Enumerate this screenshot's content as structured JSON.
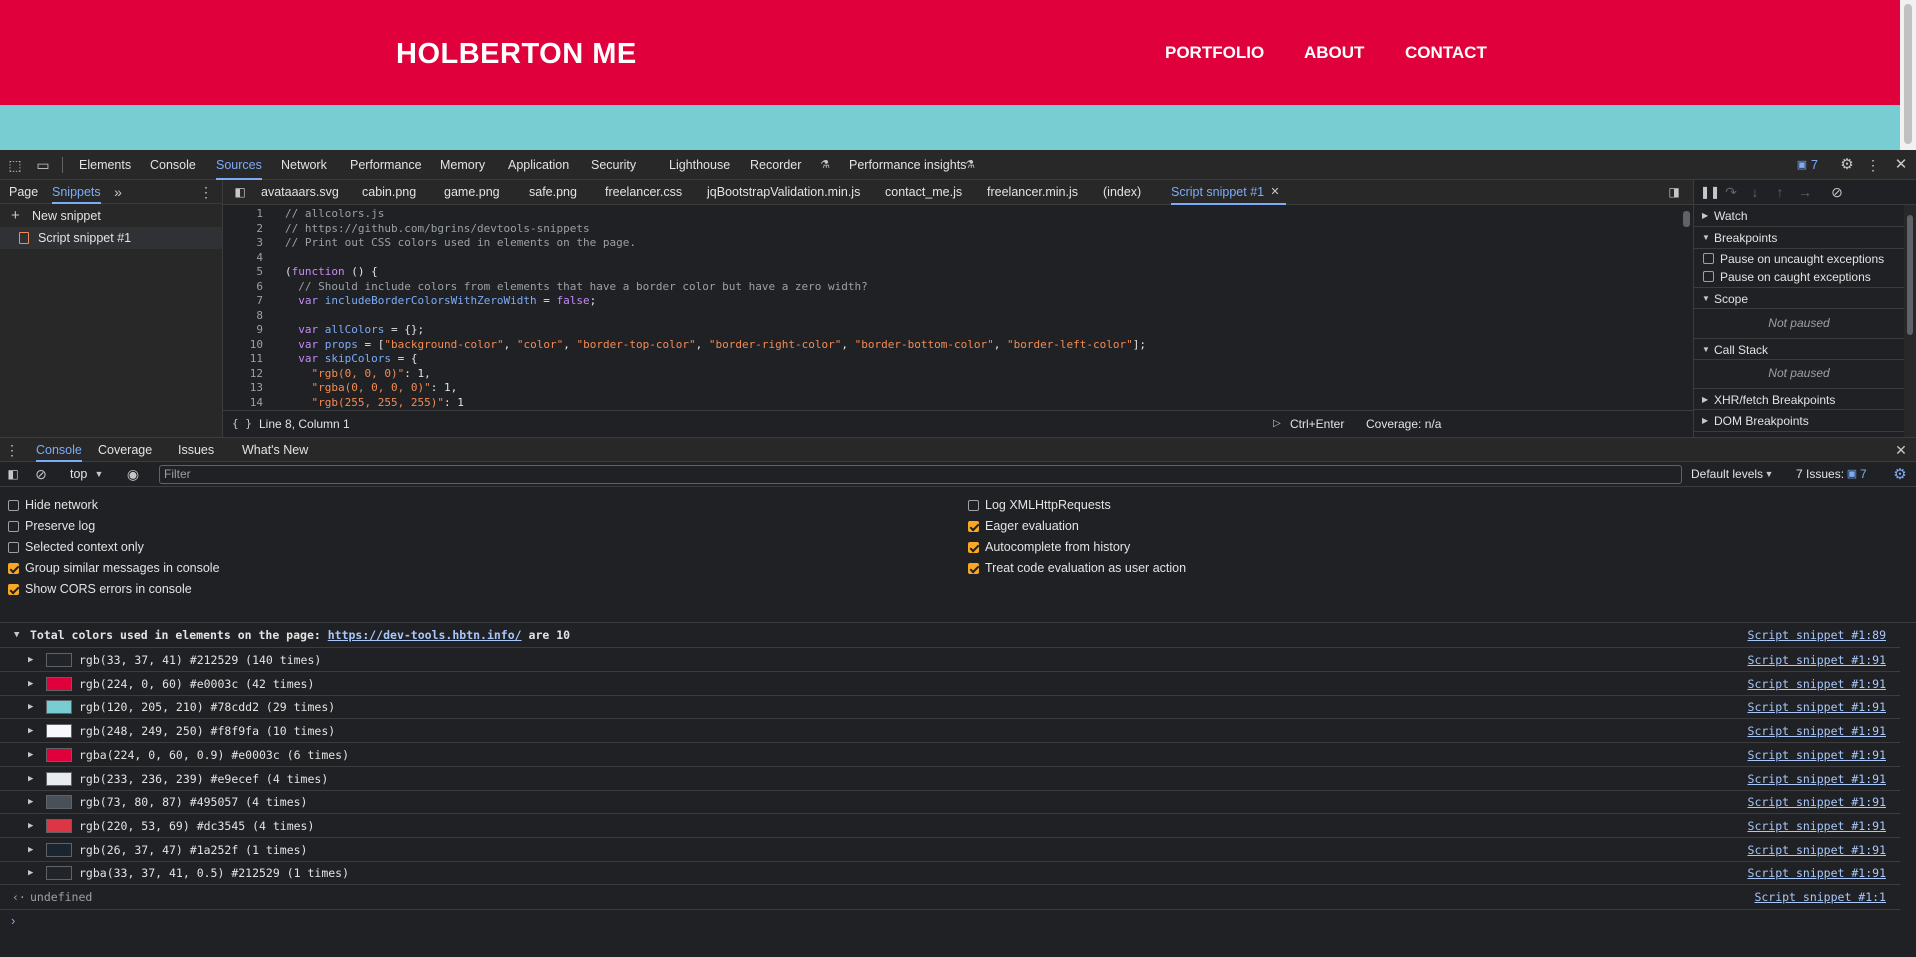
{
  "page": {
    "brand": "HOLBERTON ME",
    "nav": [
      "PORTFOLIO",
      "ABOUT",
      "CONTACT"
    ],
    "colors": {
      "header": "#e0003c",
      "band": "#78cdd2"
    }
  },
  "devtools": {
    "main_tabs": [
      "Elements",
      "Console",
      "Sources",
      "Network",
      "Performance",
      "Memory",
      "Application",
      "Security",
      "Lighthouse",
      "Recorder",
      "Performance insights"
    ],
    "active_tab": "Sources",
    "issues_badge": "7",
    "navigator_tabs": [
      "Page",
      "Snippets"
    ],
    "new_snippet": "New snippet",
    "snippet_name": "Script snippet #1",
    "file_tabs": [
      "avataaars.svg",
      "cabin.png",
      "game.png",
      "safe.png",
      "freelancer.css",
      "jqBootstrapValidation.min.js",
      "contact_me.js",
      "freelancer.min.js",
      "(index)",
      "Script snippet #1"
    ],
    "code_lines": [
      "// allcolors.js",
      "// https://github.com/bgrins/devtools-snippets",
      "// Print out CSS colors used in elements on the page.",
      "",
      "(function () {",
      "  // Should include colors from elements that have a border color but have a zero width?",
      "  var includeBorderColorsWithZeroWidth = false;",
      "",
      "  var allColors = {};",
      "  var props = [\"background-color\", \"color\", \"border-top-color\", \"border-right-color\", \"border-bottom-color\", \"border-left-color\"];",
      "  var skipColors = {",
      "    \"rgb(0, 0, 0)\": 1,",
      "    \"rgba(0, 0, 0, 0)\": 1,",
      "    \"rgb(255, 255, 255)\": 1"
    ],
    "status": {
      "position": "Line 8, Column 1",
      "run": "Ctrl+Enter",
      "coverage": "Coverage: n/a"
    },
    "debugger": {
      "watch": "Watch",
      "breakpoints": "Breakpoints",
      "pause_uncaught": "Pause on uncaught exceptions",
      "pause_caught": "Pause on caught exceptions",
      "scope": "Scope",
      "not_paused": "Not paused",
      "call_stack": "Call Stack",
      "xhr": "XHR/fetch Breakpoints",
      "dom": "DOM Breakpoints"
    },
    "drawer_tabs": [
      "Console",
      "Coverage",
      "Issues",
      "What's New"
    ],
    "console_toolbar": {
      "context": "top",
      "filter_placeholder": "Filter",
      "levels": "Default levels",
      "issues": "7 Issues:",
      "issues_count": "7"
    },
    "settings_left": [
      {
        "label": "Hide network",
        "checked": false
      },
      {
        "label": "Preserve log",
        "checked": false
      },
      {
        "label": "Selected context only",
        "checked": false
      },
      {
        "label": "Group similar messages in console",
        "checked": true
      },
      {
        "label": "Show CORS errors in console",
        "checked": true
      }
    ],
    "settings_right": [
      {
        "label": "Log XMLHttpRequests",
        "checked": false
      },
      {
        "label": "Eager evaluation",
        "checked": true
      },
      {
        "label": "Autocomplete from history",
        "checked": true
      },
      {
        "label": "Treat code evaluation as user action",
        "checked": true
      }
    ],
    "log_group": {
      "prefix": "Total colors used in elements on the page: ",
      "url": "https://dev-tools.hbtn.info/",
      "suffix": " are 10",
      "source": "Script snippet #1:89"
    },
    "log_rows": [
      {
        "text": "rgb(33, 37, 41) #212529 (140 times)",
        "color": "#212529",
        "source": "Script snippet #1:91"
      },
      {
        "text": "rgb(224, 0, 60) #e0003c (42 times)",
        "color": "#e0003c",
        "source": "Script snippet #1:91"
      },
      {
        "text": "rgb(120, 205, 210) #78cdd2 (29 times)",
        "color": "#78cdd2",
        "source": "Script snippet #1:91"
      },
      {
        "text": "rgb(248, 249, 250) #f8f9fa (10 times)",
        "color": "#f8f9fa",
        "source": "Script snippet #1:91"
      },
      {
        "text": "rgba(224, 0, 60, 0.9) #e0003c (6 times)",
        "color": "#e0003c",
        "source": "Script snippet #1:91"
      },
      {
        "text": "rgb(233, 236, 239) #e9ecef (4 times)",
        "color": "#e9ecef",
        "source": "Script snippet #1:91"
      },
      {
        "text": "rgb(73, 80, 87) #495057 (4 times)",
        "color": "#495057",
        "source": "Script snippet #1:91"
      },
      {
        "text": "rgb(220, 53, 69) #dc3545 (4 times)",
        "color": "#dc3545",
        "source": "Script snippet #1:91"
      },
      {
        "text": "rgb(26, 37, 47) #1a252f (1 times)",
        "color": "#1a252f",
        "source": "Script snippet #1:91"
      },
      {
        "text": "rgba(33, 37, 41, 0.5) #212529 (1 times)",
        "color": "#212529",
        "source": "Script snippet #1:91"
      }
    ],
    "result": {
      "text": "undefined",
      "source": "Script snippet #1:1"
    }
  }
}
